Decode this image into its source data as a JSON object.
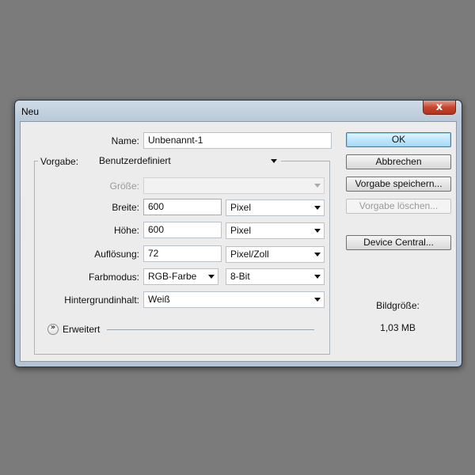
{
  "window": {
    "title": "Neu",
    "close_glyph": "x"
  },
  "form": {
    "name_label": "Name:",
    "name_value": "Unbenannt-1",
    "preset_label": "Vorgabe:",
    "preset_value": "Benutzerdefiniert",
    "size_label": "Größe:",
    "size_value": "",
    "width_label": "Breite:",
    "width_value": "600",
    "width_unit": "Pixel",
    "height_label": "Höhe:",
    "height_value": "600",
    "height_unit": "Pixel",
    "resolution_label": "Auflösung:",
    "resolution_value": "72",
    "resolution_unit": "Pixel/Zoll",
    "colormode_label": "Farbmodus:",
    "colormode_value": "RGB-Farbe",
    "bitdepth_value": "8-Bit",
    "background_label": "Hintergrundinhalt:",
    "background_value": "Weiß",
    "advanced_label": "Erweitert"
  },
  "buttons": {
    "ok": "OK",
    "cancel": "Abbrechen",
    "save_preset": "Vorgabe speichern...",
    "delete_preset": "Vorgabe löschen...",
    "device_central": "Device Central..."
  },
  "info": {
    "image_size_label": "Bildgröße:",
    "image_size_value": "1,03 MB"
  },
  "icons": {
    "close": "close-icon",
    "dropdown": "chevron-down-icon",
    "expander": "double-chevron-down-icon"
  }
}
